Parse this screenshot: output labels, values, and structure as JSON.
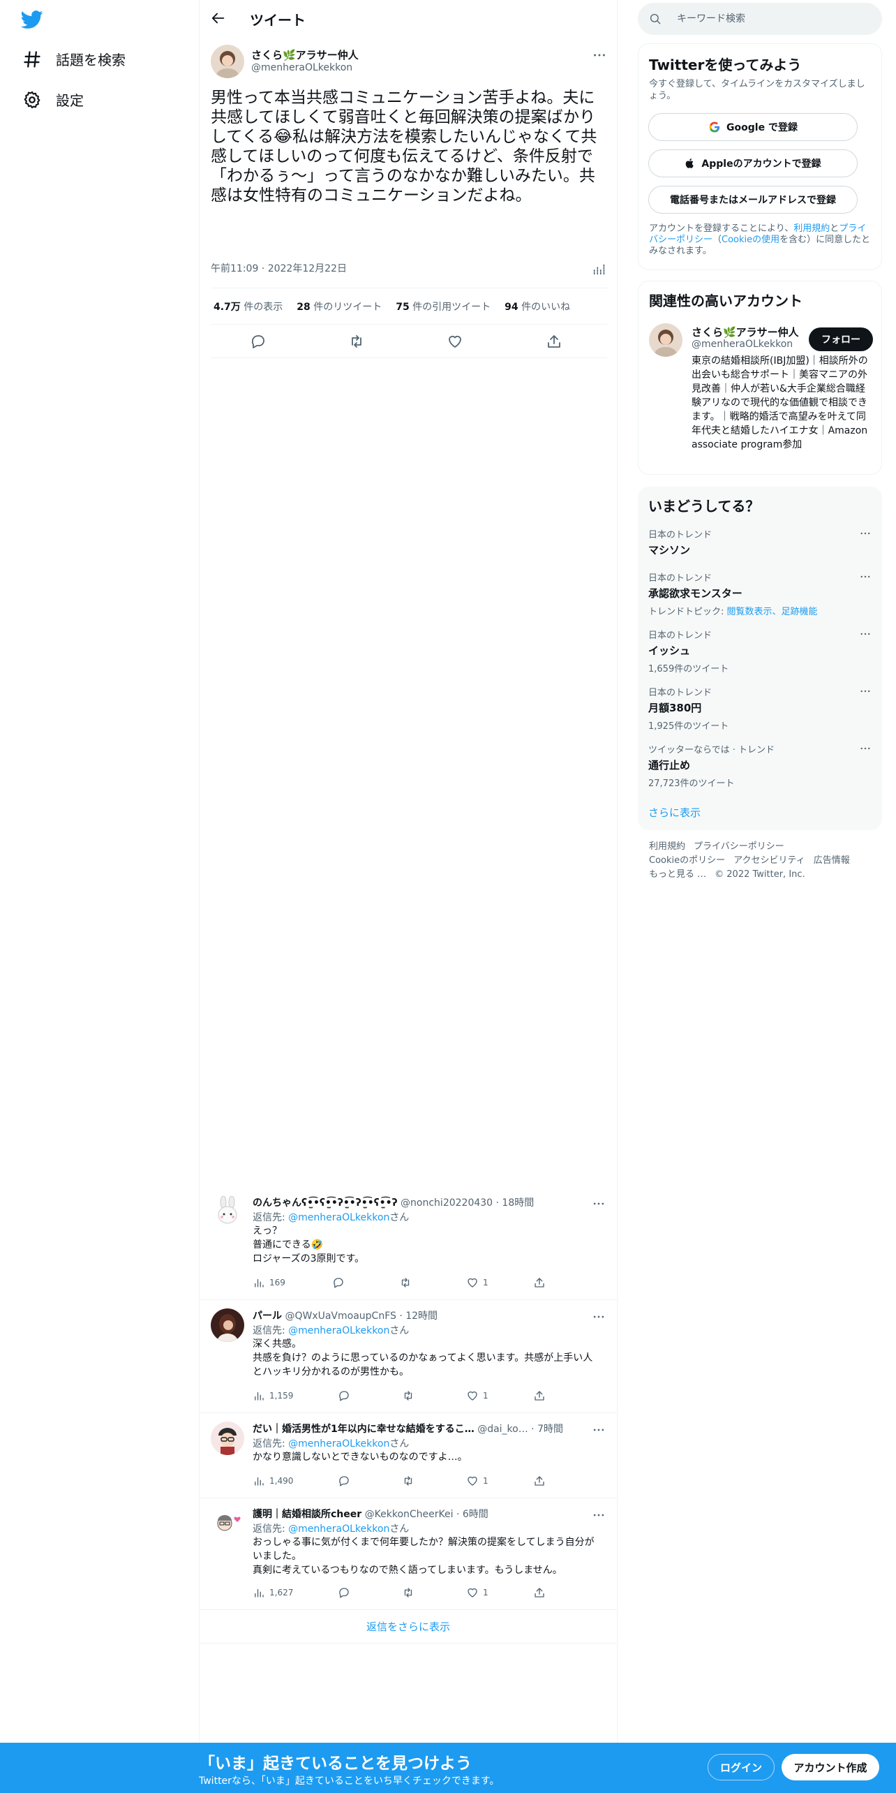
{
  "nav": {
    "explore_label": "話題を検索",
    "settings_label": "設定"
  },
  "header": {
    "title": "ツイート"
  },
  "tweet": {
    "author_name": "さくら🌿アラサー仲人",
    "author_handle": "@menheraOLkekkon",
    "text": "男性って本当共感コミュニケーション苦手よね。夫に共感してほしくて弱音吐くと毎回解決策の提案ばかりしてくる😂私は解決方法を模索したいんじゃなくて共感してほしいのって何度も伝えてるけど、条件反射で「わかるぅ〜」って言うのなかなか難しいみたい。共感は女性特有のコミュニケーションだよね。",
    "time": "午前11:09 · 2022年12月22日",
    "stats": [
      {
        "count": "4.7万",
        "label": "件の表示"
      },
      {
        "count": "28",
        "label": "件のリツイート"
      },
      {
        "count": "75",
        "label": "件の引用ツイート"
      },
      {
        "count": "94",
        "label": "件のいいね"
      }
    ]
  },
  "replies": [
    {
      "name": "のんちゃんʕ•̫͡•ʕ•̫͡•ʔ•̫͡•ʔ•̫͡•ʕ•̫͡•ʔ",
      "meta": "@nonchi20220430 · 18時間",
      "replyto_prefix": "返信先: ",
      "replyto_handle": "@menheraOLkekkon",
      "replyto_suffix": "さん",
      "text": "えっ？\n普通にできる🤣\nロジャーズの3原則です。",
      "views": "169",
      "likes": "1"
    },
    {
      "name": "パール",
      "meta": "@QWxUaVmoaupCnFS · 12時間",
      "replyto_prefix": "返信先: ",
      "replyto_handle": "@menheraOLkekkon",
      "replyto_suffix": "さん",
      "text": "深く共感。\n共感を負け？のように思っているのかなぁってよく思います。共感が上手い人とハッキリ分かれるのが男性かも。",
      "views": "1,159",
      "likes": "1"
    },
    {
      "name": "だい｜婚活男性が1年以内に幸せな結婚をするこ…",
      "meta": "@dai_ko… · 7時間",
      "replyto_prefix": "返信先: ",
      "replyto_handle": "@menheraOLkekkon",
      "replyto_suffix": "さん",
      "text": "かなり意識しないとできないものなのですよ…。",
      "views": "1,490",
      "likes": "1"
    },
    {
      "name": "護明｜結婚相談所cheer",
      "meta": "@KekkonCheerKei · 6時間",
      "replyto_prefix": "返信先: ",
      "replyto_handle": "@menheraOLkekkon",
      "replyto_suffix": "さん",
      "text": "おっしゃる事に気が付くまで何年要したか？解決策の提案をしてしまう自分がいました。\n真剣に考えているつもりなので熱く語ってしまいます。もうしません。",
      "views": "1,627",
      "likes": "1"
    }
  ],
  "show_more_replies": "返信をさらに表示",
  "search": {
    "placeholder": "キーワード検索"
  },
  "signup": {
    "title": "Twitterを使ってみよう",
    "subtitle": "今すぐ登録して、タイムラインをカスタマイズしましょう。",
    "google": "Google で登録",
    "apple": "Appleのアカウントで登録",
    "phone": "電話番号またはメールアドレスで登録",
    "legal_1": "アカウントを登録することにより、",
    "legal_terms": "利用規約",
    "legal_and": "と",
    "legal_privacy": "プライバシーポリシー",
    "legal_2": "（",
    "legal_cookie": "Cookieの使用",
    "legal_3": "を含む）に同意したとみなされます。"
  },
  "related": {
    "title": "関連性の高いアカウント",
    "name": "さくら🌿アラサー仲人",
    "handle": "@menheraOLkekkon",
    "follow": "フォロー",
    "bio": "東京の結婚相談所(IBJ加盟)｜相談所外の出会いも総合サポート｜美容マニアの外見改善｜仲人が若い&大手企業総合職経験アリなので現代的な価値観で相談できます。｜戦略的婚活で高望みを叶えて同年代夫と結婚したハイエナ女｜Amazon associate program参加"
  },
  "trends": {
    "title": "いまどうしてる？",
    "items": [
      {
        "category": "日本のトレンド",
        "name": "マシソン",
        "count": ""
      },
      {
        "category": "日本のトレンド",
        "name": "承認欲求モンスター",
        "count_prefix": "トレンドトピック: ",
        "count_link": "閲覧数表示、足跡機能"
      },
      {
        "category": "日本のトレンド",
        "name": "イッシュ",
        "count": "1,659件のツイート"
      },
      {
        "category": "日本のトレンド",
        "name": "月額380円",
        "count": "1,925件のツイート"
      },
      {
        "category": "ツイッターならでは · トレンド",
        "name": "通行止め",
        "count": "27,723件のツイート"
      }
    ],
    "show_more": "さらに表示"
  },
  "footer": {
    "links": [
      "利用規約",
      "プライバシーポリシー",
      "Cookieのポリシー",
      "アクセシビリティ",
      "広告情報",
      "もっと見る …",
      "© 2022 Twitter, Inc."
    ]
  },
  "bottombar": {
    "title": "「いま」起きていることを見つけよう",
    "subtitle": "Twitterなら、「いま」起きていることをいち早くチェックできます。",
    "login": "ログイン",
    "signup": "アカウント作成"
  },
  "colors": {
    "accent": "#1d9bf0",
    "text": "#0f1419",
    "muted": "#536471",
    "border": "#eff3f4"
  }
}
